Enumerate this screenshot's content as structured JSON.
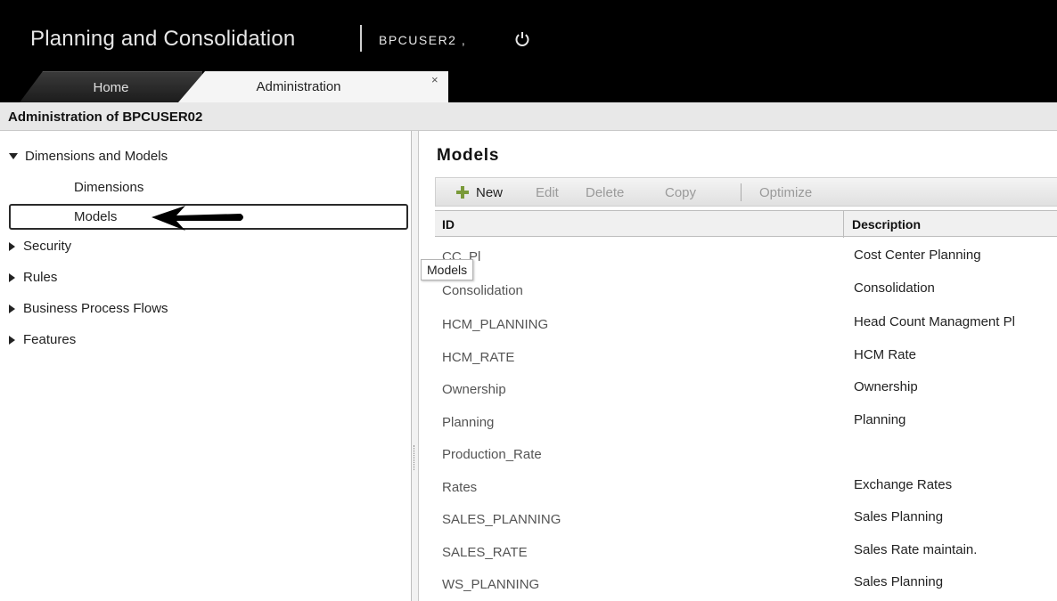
{
  "header": {
    "app_title": "Planning and Consolidation",
    "user": "BPCUSER2 ,",
    "tabs": [
      {
        "label": "Home"
      },
      {
        "label": "Administration"
      }
    ],
    "close_glyph": "×"
  },
  "page": {
    "title": "Administration of BPCUSER02"
  },
  "nav": {
    "items": [
      {
        "label": "Dimensions and Models",
        "expanded": true
      },
      {
        "label": "Dimensions"
      },
      {
        "label": "Models",
        "selected": true
      },
      {
        "label": "Security"
      },
      {
        "label": "Rules"
      },
      {
        "label": "Business Process Flows"
      },
      {
        "label": "Features"
      }
    ]
  },
  "main": {
    "title": "Models",
    "toolbar": {
      "new": "New",
      "edit": "Edit",
      "delete": "Delete",
      "copy": "Copy",
      "optimize": "Optimize"
    },
    "columns": {
      "id": "ID",
      "description": "Description"
    },
    "rows": [
      {
        "id": "CC_Pl",
        "description": "Cost Center Planning"
      },
      {
        "id": "Consolidation",
        "description": "Consolidation"
      },
      {
        "id": "HCM_PLANNING",
        "description": "Head Count Managment Pl"
      },
      {
        "id": "HCM_RATE",
        "description": "HCM Rate"
      },
      {
        "id": "Ownership",
        "description": "Ownership"
      },
      {
        "id": "Planning",
        "description": "Planning"
      },
      {
        "id": "Production_Rate",
        "description": ""
      },
      {
        "id": "Rates",
        "description": "Exchange Rates"
      },
      {
        "id": "SALES_PLANNING",
        "description": "Sales Planning"
      },
      {
        "id": "SALES_RATE",
        "description": "Sales Rate maintain."
      },
      {
        "id": "WS_PLANNING",
        "description": "Sales Planning"
      }
    ]
  },
  "tooltip": "Models",
  "colors": {
    "header_bg": "#000000",
    "accent_plus": "#7a9a3a"
  }
}
